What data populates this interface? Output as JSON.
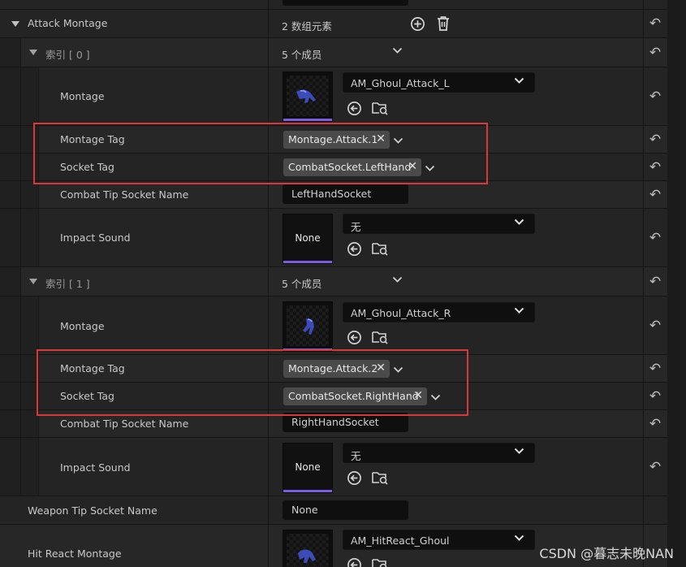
{
  "attack_montage": {
    "label": "Attack Montage",
    "count_text": "2 数组元素"
  },
  "elements": [
    {
      "index_label": "索引 [ 0 ]",
      "members_text": "5 个成员",
      "montage_label": "Montage",
      "montage_value": "AM_Ghoul_Attack_L",
      "montage_tag_label": "Montage Tag",
      "montage_tag_value": "Montage.Attack.1",
      "socket_tag_label": "Socket Tag",
      "socket_tag_value": "CombatSocket.LeftHand",
      "combat_tip_label": "Combat Tip Socket Name",
      "combat_tip_value": "LeftHandSocket",
      "impact_sound_label": "Impact Sound",
      "impact_sound_thumb": "None",
      "impact_sound_value": "无"
    },
    {
      "index_label": "索引 [ 1 ]",
      "members_text": "5 个成员",
      "montage_label": "Montage",
      "montage_value": "AM_Ghoul_Attack_R",
      "montage_tag_label": "Montage Tag",
      "montage_tag_value": "Montage.Attack.2",
      "socket_tag_label": "Socket Tag",
      "socket_tag_value": "CombatSocket.RightHand",
      "combat_tip_label": "Combat Tip Socket Name",
      "combat_tip_value": "RightHandSocket",
      "impact_sound_label": "Impact Sound",
      "impact_sound_thumb": "None",
      "impact_sound_value": "无"
    }
  ],
  "weapon_tip": {
    "label": "Weapon Tip Socket Name",
    "value": "None"
  },
  "hit_react": {
    "label": "Hit React Montage",
    "value": "AM_HitReact_Ghoul"
  },
  "watermark": "CSDN @暮志未晚NAN",
  "icons": {
    "add": "plus-circle-icon",
    "delete": "trash-icon",
    "reset": "reset-arrow-icon",
    "browse": "arrow-left-circle-icon",
    "find": "folder-search-icon",
    "expand": "chevron-down-icon",
    "clear": "x-icon"
  },
  "colors": {
    "highlight_box": "#d8383a",
    "thumbnail_bar": "#7a5de0"
  }
}
